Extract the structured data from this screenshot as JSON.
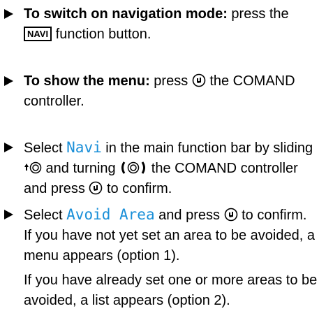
{
  "steps": [
    {
      "bold": "To switch on navigation mode:",
      "t1": " press the",
      "key": "NAVI",
      "t2": " function button."
    },
    {
      "bold": "To show the menu:",
      "t1": " press",
      "t2": " the COMAND controller."
    },
    {
      "t1": "Select ",
      "hl": "Navi",
      "t2": " in the main function bar by sliding",
      "t3": " and turning",
      "t4": " the COMAND controller and press",
      "t5": " to confirm."
    },
    {
      "t1": "Select ",
      "hl": "Avoid Area",
      "t2": " and press",
      "t3": " to confirm.",
      "note1": "If you have not yet set an area to be avoided, a menu appears (option 1).",
      "note2": "If you have already set one or more areas to be avoided, a list appears (option 2)."
    }
  ],
  "colors": {
    "highlight": "#1a8fd8"
  },
  "icons": [
    "controller-press-icon",
    "controller-slide-up-icon",
    "controller-turn-icon"
  ]
}
